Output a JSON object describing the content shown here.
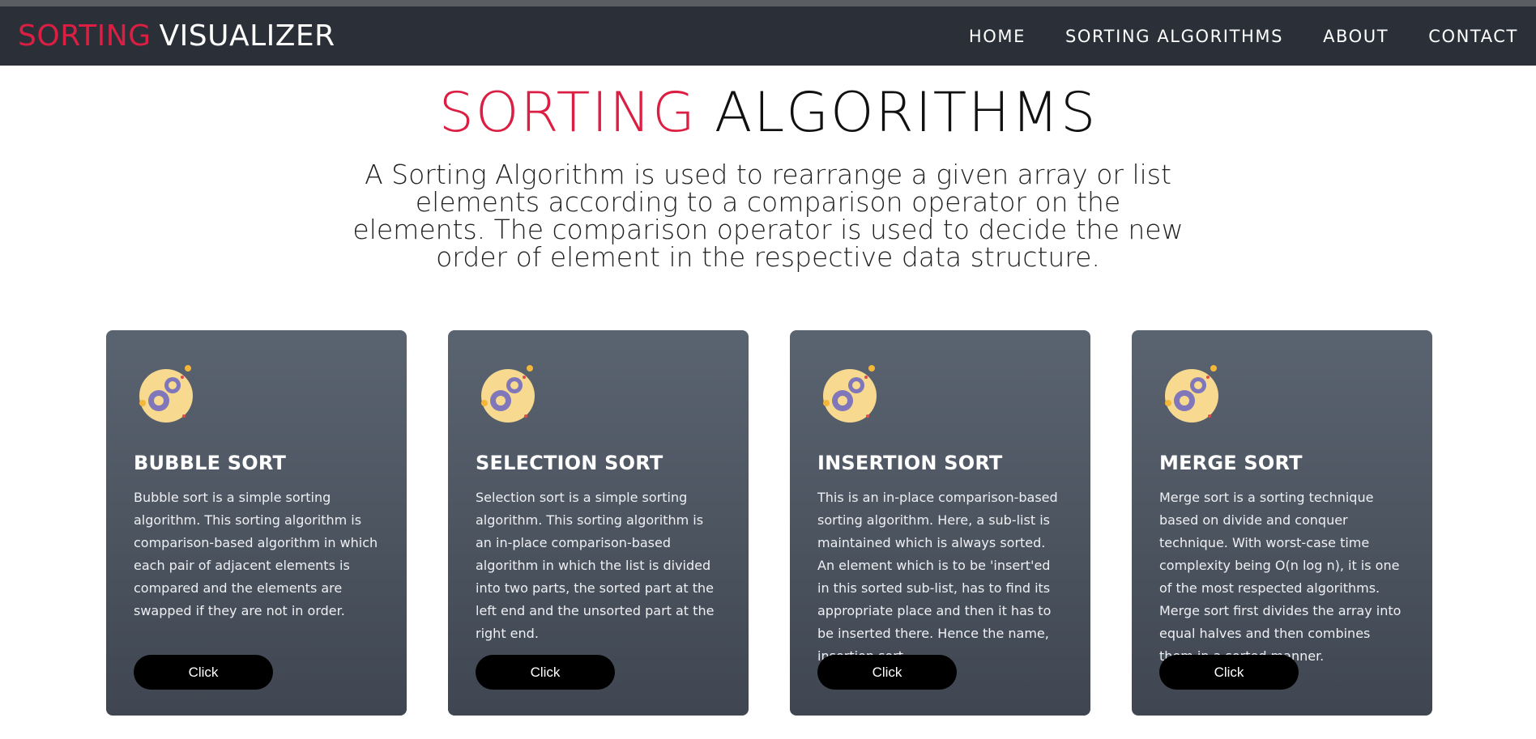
{
  "nav": {
    "brand_part1": "SORTING",
    "brand_part2": "VISUALIZER",
    "links": [
      "HOME",
      "SORTING ALGORITHMS",
      "ABOUT",
      "CONTACT"
    ]
  },
  "hero": {
    "title_red": "SORTING",
    "title_dark": "ALGORITHMS",
    "description": "A Sorting Algorithm is used to rearrange a given array or list elements according to a comparison operator on the elements. The comparison operator is used to decide the new order of element in the respective data structure."
  },
  "colors": {
    "accent": "#dc1e43",
    "navbar": "#2b3038",
    "card": "#4b535e",
    "button": "#000000",
    "icon_circle": "#f7d98f",
    "gear": "#7f77b9"
  },
  "cards": [
    {
      "icon": "gears-icon",
      "title": "BUBBLE SORT",
      "text": "Bubble sort is a simple sorting algorithm. This sorting algorithm is comparison-based algorithm in which each pair of adjacent elements is compared and the elements are swapped if they are not in order.",
      "button": "Click"
    },
    {
      "icon": "gears-icon",
      "title": "SELECTION SORT",
      "text": "Selection sort is a simple sorting algorithm. This sorting algorithm is an in-place comparison-based algorithm in which the list is divided into two parts, the sorted part at the left end and the unsorted part at the right end.",
      "button": "Click"
    },
    {
      "icon": "gears-icon",
      "title": "INSERTION SORT",
      "text": "This is an in-place comparison-based sorting algorithm. Here, a sub-list is maintained which is always sorted. An element which is to be 'insert'ed in this sorted sub-list, has to find its appropriate place and then it has to be inserted there. Hence the name, insertion sort.",
      "button": "Click"
    },
    {
      "icon": "gears-icon",
      "title": "MERGE SORT",
      "text": "Merge sort is a sorting technique based on divide and conquer technique. With worst-case time complexity being O(n log n), it is one of the most respected algorithms. Merge sort first divides the array into equal halves and then combines them in a sorted manner.",
      "button": "Click"
    }
  ]
}
